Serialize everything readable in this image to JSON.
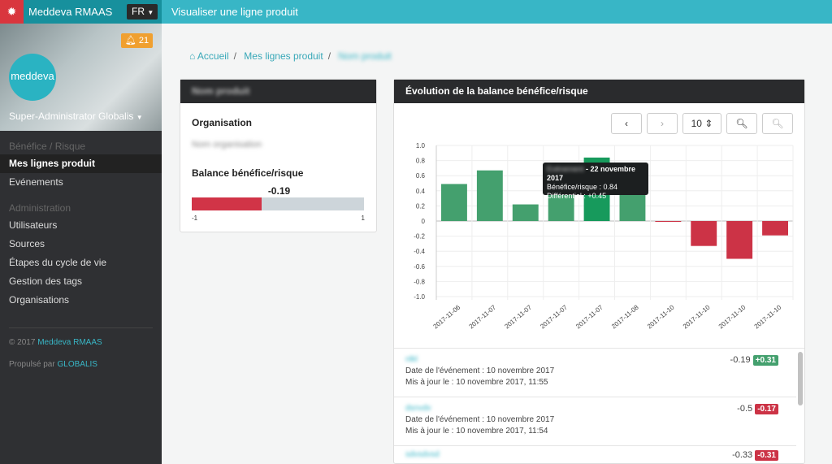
{
  "header": {
    "brand": "Meddeva RMAAS",
    "lang": "FR",
    "page_title": "Visualiser une ligne produit",
    "bug_icon": "bug-icon"
  },
  "sidebar": {
    "alert_count": "21",
    "logo": "meddeva",
    "user": "Super-Administrator Globalis",
    "section1": "Bénéfice / Risque",
    "items1": [
      "Mes lignes produit",
      "Evénements"
    ],
    "section2": "Administration",
    "items2": [
      "Utilisateurs",
      "Sources",
      "Étapes du cycle de vie",
      "Gestion des tags",
      "Organisations"
    ],
    "copyright": "© 2017",
    "copyright_link": "Meddeva RMAAS",
    "powered": "Propulsé par",
    "powered_link": "GLOBALIS"
  },
  "breadcrumb": {
    "home": "Accueil",
    "list": "Mes lignes produit",
    "current": "Nom produit"
  },
  "product": {
    "title": "Nom produit",
    "org_label": "Organisation",
    "org_value": "Nom organisation",
    "balance_label": "Balance bénéfice/risque",
    "balance_value": "-0.19",
    "balance_fraction": 0.405,
    "min": "-1",
    "max": "1",
    "fill_color": "#d13447"
  },
  "chart_panel": {
    "title": "Évolution de la balance bénéfice/risque",
    "page_size": "10"
  },
  "chart_data": {
    "type": "bar",
    "categories": [
      "2017-11-06",
      "2017-11-07",
      "2017-11-07",
      "2017-11-07",
      "2017-11-07",
      "2017-11-08",
      "2017-11-10",
      "2017-11-10",
      "2017-11-10",
      "2017-11-10"
    ],
    "values": [
      0.49,
      0.67,
      0.22,
      0.55,
      0.84,
      0.6,
      -0.01,
      -0.33,
      -0.5,
      -0.19
    ],
    "ylim": [
      -1,
      1
    ],
    "yticks": [
      "1.0",
      "0.8",
      "0.6",
      "0.4",
      "0.2",
      "0",
      "-0.2",
      "-0.4",
      "-0.6",
      "-0.8",
      "-1.0"
    ],
    "grid": true,
    "positive_color": "#44a06e",
    "negative_color": "#cc3346",
    "highlight_color": "#179a5c",
    "highlight_index": 4
  },
  "tooltip": {
    "name": "Evénement",
    "date": " - 22 novembre 2017",
    "line1": "Bénéfice/risque : 0.84",
    "line2": "Différentiel : +0.45"
  },
  "events": [
    {
      "name": "nlkl",
      "date": "Date de l'événement : 10 novembre 2017",
      "updated": "Mis à jour le : 10 novembre 2017, 11:55",
      "value": "-0.19",
      "diff": "+0.31",
      "diff_color": "#44a06e"
    },
    {
      "name": "dsnvdv",
      "date": "Date de l'événement : 10 novembre 2017",
      "updated": "Mis à jour le : 10 novembre 2017, 11:54",
      "value": "-0.5",
      "diff": "-0.17",
      "diff_color": "#cc3346"
    },
    {
      "name": "sdvsdvsd",
      "date": "",
      "updated": "",
      "value": "-0.33",
      "diff": "-0.31",
      "diff_color": "#cc3346"
    }
  ]
}
